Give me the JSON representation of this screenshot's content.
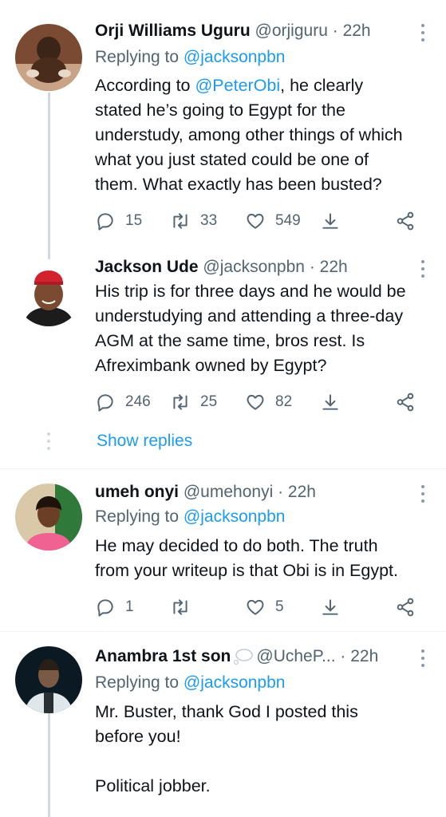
{
  "tweets": [
    {
      "name": "Orji Williams Uguru",
      "handle": "@orjiguru",
      "dot": "·",
      "time": "22h",
      "reply_prefix": "Replying to",
      "reply_handle": "@jacksonpbn",
      "lines_pre": "According to ",
      "mention": "@PeterObi",
      "lines_first_rest": ", he clearly",
      "lines": [
        "stated he’s going to Egypt for the",
        "understudy, among other things of which",
        "what you just stated could be one of",
        "them. What exactly has been busted?"
      ],
      "replies": "15",
      "retweets": "33",
      "likes": "549",
      "avatar_icon": "baby-photo-avatar"
    },
    {
      "name": "Jackson Ude",
      "handle": "@jacksonpbn",
      "dot": "·",
      "time": "22h",
      "lines": [
        "His trip is for three days and he would be",
        "understudying and attending a three-day",
        "AGM at the same time, bros rest. Is",
        "Afreximbank owned by Egypt?"
      ],
      "replies": "246",
      "retweets": "25",
      "likes": "82",
      "show_replies": "Show replies",
      "avatar_icon": "man-red-cap-avatar"
    },
    {
      "name": "umeh onyi",
      "handle": "@umehonyi",
      "dot": "·",
      "time": "22h",
      "reply_prefix": "Replying to",
      "reply_handle": "@jacksonpbn",
      "lines": [
        "He may decided to do both. The truth",
        "from your writeup is that Obi is in Egypt."
      ],
      "replies": "1",
      "retweets": "",
      "likes": "5",
      "avatar_icon": "woman-pink-avatar"
    },
    {
      "name": "Anambra 1st son",
      "handle": "@UcheP...",
      "dot": "·",
      "time": "22h",
      "reply_prefix": "Replying to",
      "reply_handle": "@jacksonpbn",
      "lines": [
        "Mr. Buster, thank God I posted this",
        "before you!",
        "",
        "Political jobber."
      ],
      "avatar_icon": "game-character-avatar"
    }
  ],
  "icons": {
    "reply": "reply-icon",
    "retweet": "retweet-icon",
    "like": "heart-icon",
    "download": "download-icon",
    "share": "share-icon",
    "more": "more-icon"
  },
  "colors": {
    "link": "#1d9bf0",
    "secondary": "#536471",
    "thread_line": "#cfd9de"
  }
}
